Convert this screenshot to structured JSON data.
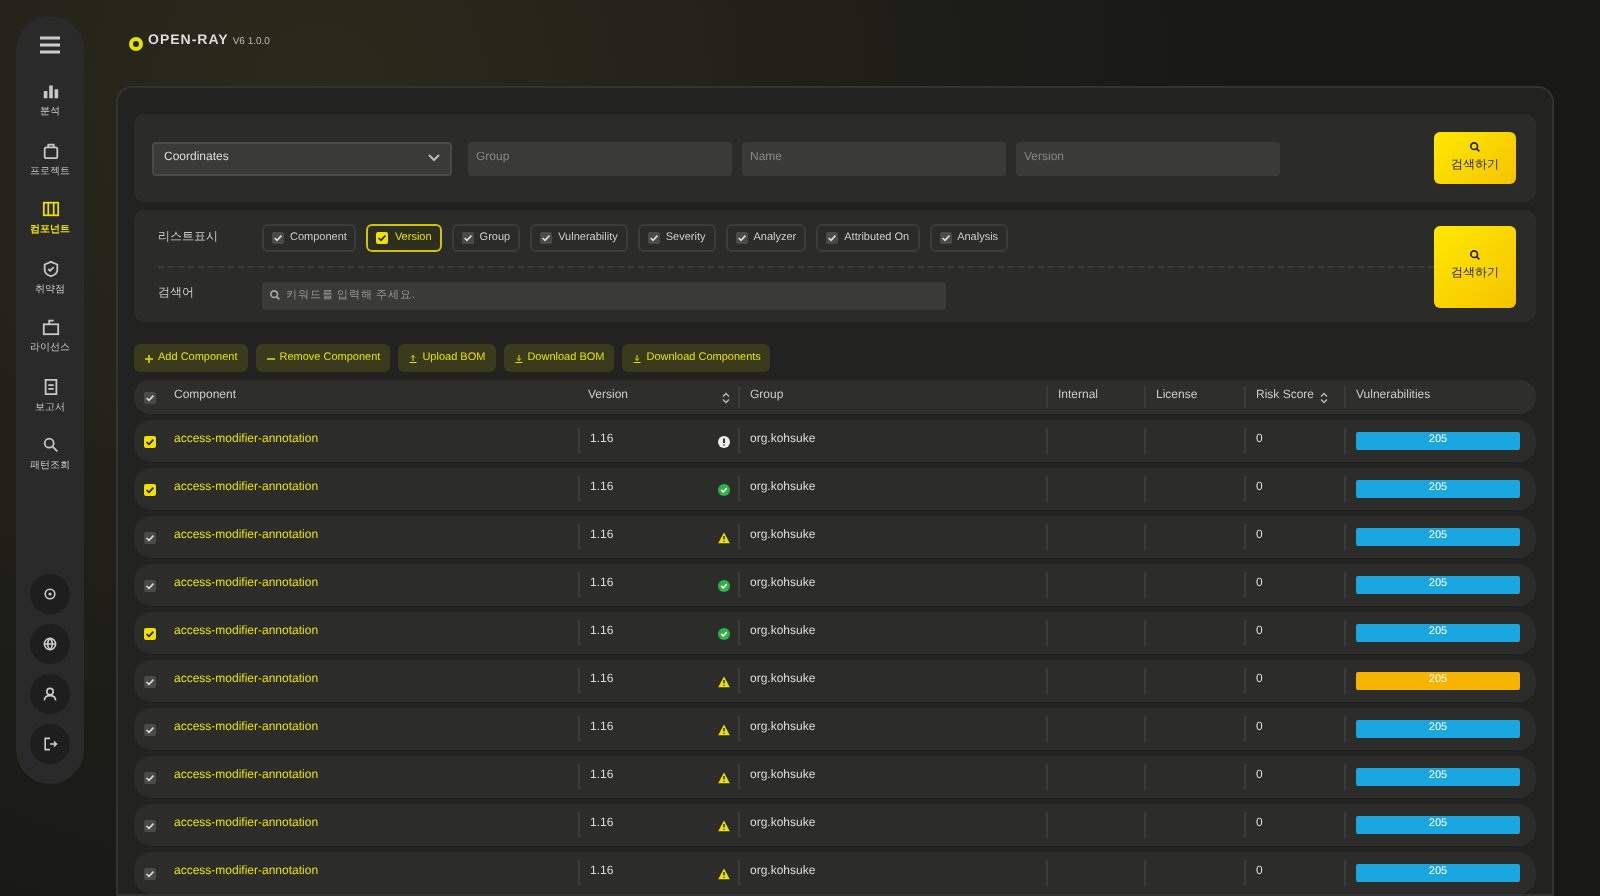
{
  "header": {
    "logo": "OPEN-RAY",
    "version": "V6 1.0.0"
  },
  "sidebar": {
    "items": [
      {
        "label": "분석",
        "selected": false
      },
      {
        "label": "프로젝트",
        "selected": false
      },
      {
        "label": "컴포넌트",
        "selected": true
      },
      {
        "label": "취약점",
        "selected": false
      },
      {
        "label": "라이선스",
        "selected": false
      },
      {
        "label": "보고서",
        "selected": false
      },
      {
        "label": "패턴조회",
        "selected": false
      }
    ]
  },
  "search": {
    "type": "Coordinates",
    "fields": [
      {
        "placeholder": "Group"
      },
      {
        "placeholder": "Name"
      },
      {
        "placeholder": "Version"
      }
    ],
    "button": "검색하기"
  },
  "filter": {
    "list_label": "리스트표시",
    "columns": [
      {
        "label": "Component",
        "checked": true,
        "selected": false
      },
      {
        "label": "Version",
        "checked": true,
        "selected": true
      },
      {
        "label": "Group",
        "checked": true,
        "selected": false
      },
      {
        "label": "Vulnerability",
        "checked": true,
        "selected": false
      },
      {
        "label": "Severity",
        "checked": true,
        "selected": false
      },
      {
        "label": "Analyzer",
        "checked": true,
        "selected": false
      },
      {
        "label": "Attributed On",
        "checked": true,
        "selected": false
      },
      {
        "label": "Analysis",
        "checked": true,
        "selected": false
      }
    ],
    "keyword_label": "검색어",
    "keyword_placeholder": "키워드를 입력해 주세요.",
    "button": "검색하기"
  },
  "actions": [
    {
      "label": "Add Component"
    },
    {
      "label": "Remove Component"
    },
    {
      "label": "Upload BOM"
    },
    {
      "label": "Download BOM"
    },
    {
      "label": "Download Components"
    }
  ],
  "table": {
    "all_checked": false,
    "columns": [
      {
        "label": "Component"
      },
      {
        "label": "Version",
        "sortable": true
      },
      {
        "label": "Group"
      },
      {
        "label": "Internal"
      },
      {
        "label": "License"
      },
      {
        "label": "Risk Score",
        "sortable": true
      },
      {
        "label": "Vulnerabilities"
      }
    ],
    "rows": [
      {
        "checked": true,
        "component": "access-modifier-annotation",
        "version": "1.16",
        "kind": "info",
        "group": "org.kohsuke",
        "risk_score": "0",
        "vulnerabilities": "205",
        "color": "#1aa7e0"
      },
      {
        "checked": true,
        "component": "access-modifier-annotation",
        "version": "1.16",
        "kind": "ok",
        "group": "org.kohsuke",
        "risk_score": "0",
        "vulnerabilities": "205",
        "color": "#1aa7e0"
      },
      {
        "checked": false,
        "component": "access-modifier-annotation",
        "version": "1.16",
        "kind": "warn",
        "group": "org.kohsuke",
        "risk_score": "0",
        "vulnerabilities": "205",
        "color": "#1aa7e0"
      },
      {
        "checked": false,
        "component": "access-modifier-annotation",
        "version": "1.16",
        "kind": "ok",
        "group": "org.kohsuke",
        "risk_score": "0",
        "vulnerabilities": "205",
        "color": "#1aa7e0"
      },
      {
        "checked": true,
        "component": "access-modifier-annotation",
        "version": "1.16",
        "kind": "ok",
        "group": "org.kohsuke",
        "risk_score": "0",
        "vulnerabilities": "205",
        "color": "#1aa7e0"
      },
      {
        "checked": false,
        "component": "access-modifier-annotation",
        "version": "1.16",
        "kind": "warn",
        "group": "org.kohsuke",
        "risk_score": "0",
        "vulnerabilities": "205",
        "color": "#f5b400"
      },
      {
        "checked": false,
        "component": "access-modifier-annotation",
        "version": "1.16",
        "kind": "warn",
        "group": "org.kohsuke",
        "risk_score": "0",
        "vulnerabilities": "205",
        "color": "#1aa7e0"
      },
      {
        "checked": false,
        "component": "access-modifier-annotation",
        "version": "1.16",
        "kind": "warn",
        "group": "org.kohsuke",
        "risk_score": "0",
        "vulnerabilities": "205",
        "color": "#1aa7e0"
      },
      {
        "checked": false,
        "component": "access-modifier-annotation",
        "version": "1.16",
        "kind": "warn",
        "group": "org.kohsuke",
        "risk_score": "0",
        "vulnerabilities": "205",
        "color": "#1aa7e0"
      },
      {
        "checked": false,
        "component": "access-modifier-annotation",
        "version": "1.16",
        "kind": "warn",
        "group": "org.kohsuke",
        "risk_score": "0",
        "vulnerabilities": "205",
        "color": "#1aa7e0"
      }
    ]
  }
}
